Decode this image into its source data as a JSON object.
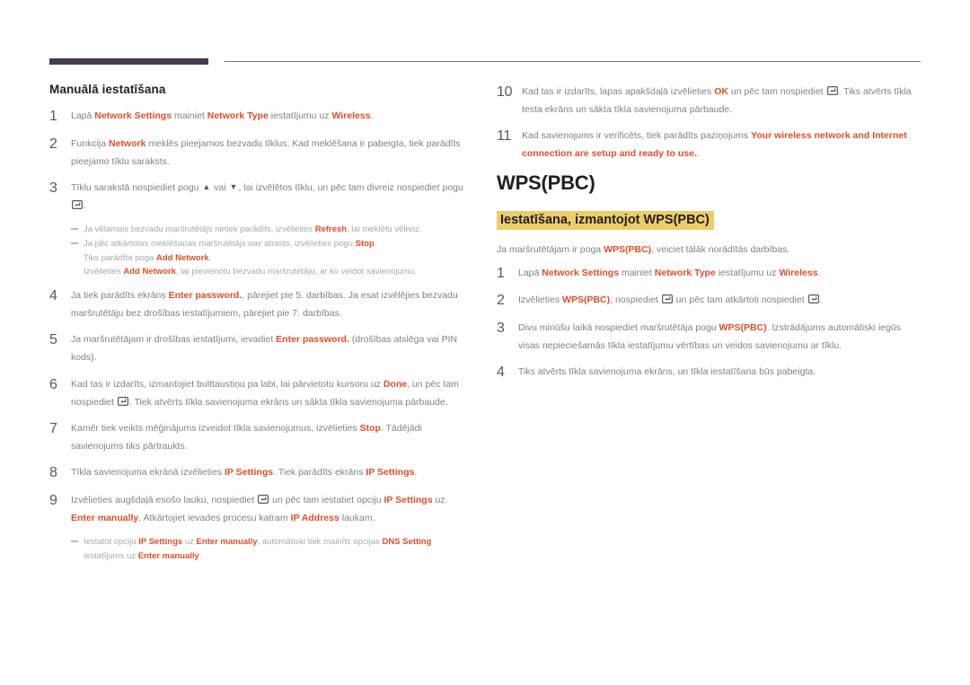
{
  "theme": {
    "accent_red": "#e04e28",
    "rule_dark": "#443c52",
    "rule_thin": "#6f7175",
    "highlight_yellow": "#eccd6a",
    "body_text": "#808285",
    "heading_text": "#231f20",
    "note_text": "#a7a9ac"
  },
  "left": {
    "section_title": "Manuālā iestatīšana",
    "steps": [
      {
        "num": "1",
        "parts": [
          {
            "t": "Lapā ",
            "k": false
          },
          {
            "t": "Network Settings",
            "k": true
          },
          {
            "t": " mainiet ",
            "k": false
          },
          {
            "t": "Network Type",
            "k": true
          },
          {
            "t": " iestatījumu uz ",
            "k": false
          },
          {
            "t": "Wireless",
            "k": true
          },
          {
            "t": ".",
            "k": false
          }
        ]
      },
      {
        "num": "2",
        "parts": [
          {
            "t": "Funkcija ",
            "k": false
          },
          {
            "t": "Network",
            "k": true
          },
          {
            "t": " meklēs pieejamos bezvadu tīklus. Kad meklēšana ir pabeigta, tiek parādīts pieejamo tīklu saraksts.",
            "k": false
          }
        ]
      },
      {
        "num": "3",
        "parts": [
          {
            "t": "Tīklu sarakstā nospiediet pogu ",
            "k": false
          },
          {
            "icon": "arrow-up"
          },
          {
            "t": " vai ",
            "k": false
          },
          {
            "icon": "arrow-down"
          },
          {
            "t": ", lai izvēlētos tīklu, un pēc tam divreiz nospiediet pogu ",
            "k": false
          },
          {
            "icon": "enter-key"
          },
          {
            "t": ".",
            "k": false
          }
        ],
        "notes": [
          {
            "dash": true,
            "parts": [
              {
                "t": "Ja vēlamais bezvadu maršrutētājs netiek parādīts, izvēlieties ",
                "k": false
              },
              {
                "t": "Refresh",
                "k": true
              },
              {
                "t": ", lai meklētu vēlreiz.",
                "k": false
              }
            ]
          },
          {
            "dash": true,
            "parts": [
              {
                "t": "Ja pēc atkārtotas meklēšanas maršrutētājs nav atrasts, izvēlieties pogu ",
                "k": false
              },
              {
                "t": "Stop",
                "k": true
              },
              {
                "t": ".",
                "k": false
              }
            ]
          },
          {
            "dash": false,
            "parts": [
              {
                "t": "Tiks parādīta poga ",
                "k": false
              },
              {
                "t": "Add Network",
                "k": true
              },
              {
                "t": ".",
                "k": false
              }
            ]
          },
          {
            "dash": false,
            "parts": [
              {
                "t": "Izvēlieties ",
                "k": false
              },
              {
                "t": "Add Network",
                "k": true
              },
              {
                "t": ", lai pievienotu bezvadu maršrutētāju, ar ko veidot savienojumu.",
                "k": false
              }
            ]
          }
        ]
      },
      {
        "num": "4",
        "parts": [
          {
            "t": "Ja tiek parādīts ekrāns ",
            "k": false
          },
          {
            "t": "Enter password.",
            "k": true
          },
          {
            "t": ", pārejiet pie 5. darbības. Ja esat izvēlējies bezvadu maršrutētāju bez drošības iestatījumiem, pārejiet pie 7. darbības.",
            "k": false
          }
        ]
      },
      {
        "num": "5",
        "parts": [
          {
            "t": "Ja maršrutētājam ir drošības iestatījumi, ievadiet ",
            "k": false
          },
          {
            "t": "Enter password.",
            "k": true
          },
          {
            "t": " (drošības atslēga vai PIN kods).",
            "k": false
          }
        ]
      },
      {
        "num": "6",
        "parts": [
          {
            "t": "Kad tas ir izdarīts, izmantojiet bulttaustiņu pa labi, lai pārvietotu kursoru uz ",
            "k": false
          },
          {
            "t": "Done",
            "k": true
          },
          {
            "t": ", un pēc tam nospiediet ",
            "k": false
          },
          {
            "icon": "enter-key"
          },
          {
            "t": ". Tiek atvērts tīkla savienojuma ekrāns un sākta tīkla savienojuma pārbaude.",
            "k": false
          }
        ]
      },
      {
        "num": "7",
        "parts": [
          {
            "t": "Kamēr tiek veikts mēģinājums izveidot tīkla savienojumus, izvēlieties ",
            "k": false
          },
          {
            "t": "Stop",
            "k": true
          },
          {
            "t": ". Tādējādi savienojums tiks pārtraukts.",
            "k": false
          }
        ]
      },
      {
        "num": "8",
        "parts": [
          {
            "t": "Tīkla savienojuma ekrānā izvēlieties ",
            "k": false
          },
          {
            "t": "IP Settings",
            "k": true
          },
          {
            "t": ". Tiek parādīts ekrāns ",
            "k": false
          },
          {
            "t": "IP Settings",
            "k": true
          },
          {
            "t": ".",
            "k": false
          }
        ]
      },
      {
        "num": "9",
        "parts": [
          {
            "t": "Izvēlieties augšdaļā esošo lauku, nospiediet ",
            "k": false
          },
          {
            "icon": "enter-key"
          },
          {
            "t": " un pēc tam iestatiet opciju ",
            "k": false
          },
          {
            "t": "IP Settings",
            "k": true
          },
          {
            "t": " uz ",
            "k": false
          },
          {
            "t": "Enter manually",
            "k": true
          },
          {
            "t": ". Atkārtojiet ievades procesu katram ",
            "k": false
          },
          {
            "t": "IP Address",
            "k": true
          },
          {
            "t": " laukam.",
            "k": false
          }
        ],
        "notes": [
          {
            "dash": true,
            "parts": [
              {
                "t": "Iestatot opciju ",
                "k": false
              },
              {
                "t": "IP Settings",
                "k": true
              },
              {
                "t": " uz ",
                "k": false
              },
              {
                "t": "Enter manually",
                "k": true
              },
              {
                "t": ", automātiski tiek mainīts opcijas ",
                "k": false
              },
              {
                "t": "DNS Setting",
                "k": true
              },
              {
                "t": " iestatījums uz ",
                "k": false
              },
              {
                "t": "Enter manually",
                "k": true
              },
              {
                "t": ".",
                "k": false
              }
            ]
          }
        ]
      }
    ]
  },
  "right": {
    "steps_continued": [
      {
        "num": "10",
        "parts": [
          {
            "t": "Kad tas ir izdarīts, lapas apakšdaļā izvēlieties ",
            "k": false
          },
          {
            "t": "OK",
            "k": true
          },
          {
            "t": " un pēc tam nospiediet ",
            "k": false
          },
          {
            "icon": "enter-key"
          },
          {
            "t": ". Tiks atvērts tīkla testa ekrāns un sākta tīkla savienojuma pārbaude.",
            "k": false
          }
        ]
      },
      {
        "num": "11",
        "parts": [
          {
            "t": "Kad savienojums ir verificēts, tiek parādīts paziņojums ",
            "k": false
          },
          {
            "t": "Your wireless network and Internet connection are setup and ready to use.",
            "k": true
          },
          {
            "t": ".",
            "k": false
          }
        ]
      }
    ],
    "big_title": "WPS(PBC)",
    "highlight_title": "Iestatīšana, izmantojot WPS(PBC)",
    "lead_parts": [
      {
        "t": "Ja maršrutētājam ir poga ",
        "k": false
      },
      {
        "t": "WPS(PBC)",
        "k": true
      },
      {
        "t": ", veiciet tālāk norādītās darbības.",
        "k": false
      }
    ],
    "steps": [
      {
        "num": "1",
        "parts": [
          {
            "t": "Lapā ",
            "k": false
          },
          {
            "t": "Network Settings",
            "k": true
          },
          {
            "t": " mainiet ",
            "k": false
          },
          {
            "t": "Network Type",
            "k": true
          },
          {
            "t": " iestatījumu uz ",
            "k": false
          },
          {
            "t": "Wireless",
            "k": true
          },
          {
            "t": ".",
            "k": false
          }
        ]
      },
      {
        "num": "2",
        "parts": [
          {
            "t": "Izvēlieties ",
            "k": false
          },
          {
            "t": "WPS(PBC)",
            "k": true
          },
          {
            "t": ", nospiediet ",
            "k": false
          },
          {
            "icon": "enter-key"
          },
          {
            "t": " un pēc tam atkārtoti nospiediet ",
            "k": false
          },
          {
            "icon": "enter-key"
          },
          {
            "t": ".",
            "k": false
          }
        ]
      },
      {
        "num": "3",
        "parts": [
          {
            "t": "Divu minūšu laikā nospiediet maršrutētāja pogu ",
            "k": false
          },
          {
            "t": "WPS(PBC)",
            "k": true
          },
          {
            "t": ". Izstrādājums automātiski iegūs visas nepieciešamās tīkla iestatījumu vērtības un veidos savienojumu ar tīklu.",
            "k": false
          }
        ]
      },
      {
        "num": "4",
        "parts": [
          {
            "t": "Tiks atvērts tīkla savienojuma ekrāns, un tīkla iestatīšana būs pabeigta.",
            "k": false
          }
        ]
      }
    ]
  }
}
